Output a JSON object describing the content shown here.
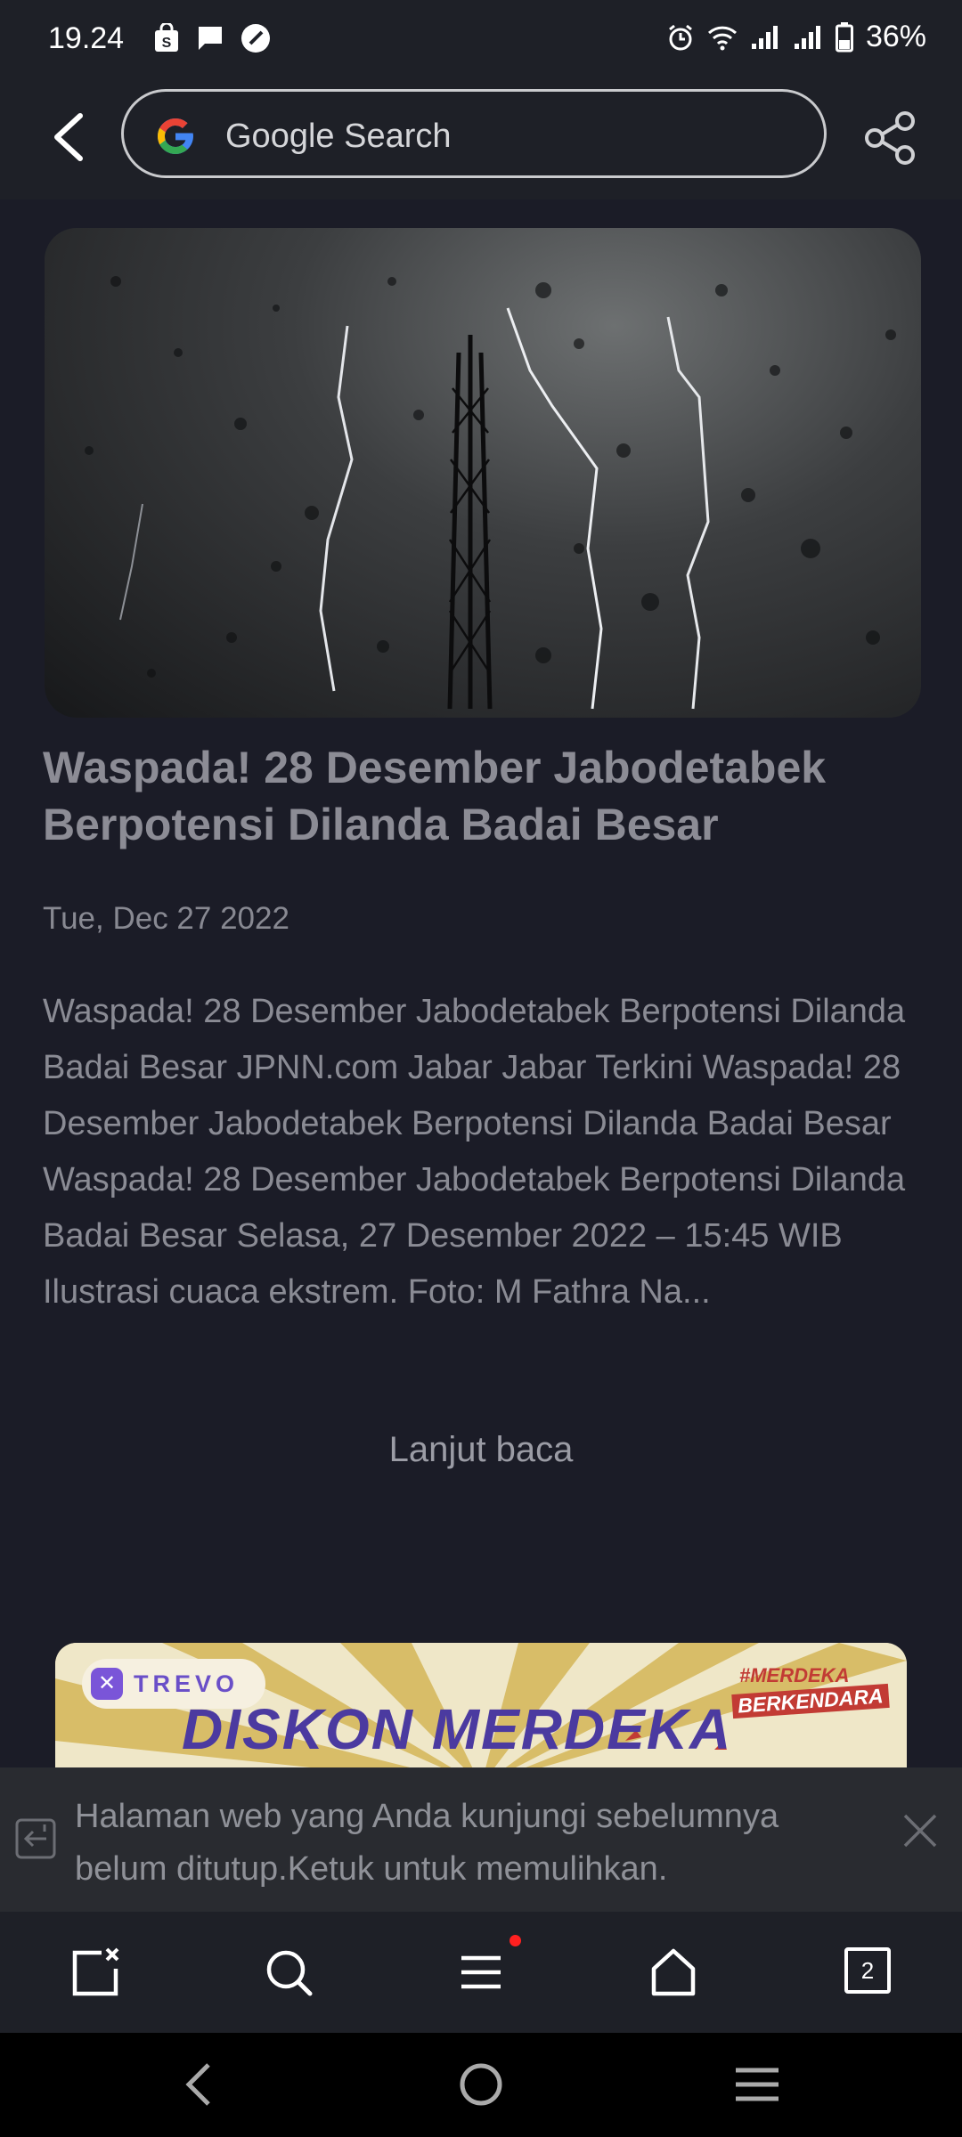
{
  "status_bar": {
    "time": "19.24",
    "battery": "36%",
    "icons": [
      "shopping-bag-icon",
      "chat-icon",
      "speed-icon",
      "alarm-icon",
      "wifi-icon",
      "signal-icon",
      "signal-icon",
      "battery-icon"
    ]
  },
  "top_bar": {
    "search_placeholder": "Google Search",
    "icons": [
      "back-arrow-icon",
      "google-logo-icon",
      "share-icon"
    ]
  },
  "article": {
    "hero_image_description_icon": "storm-lightning-tower-image",
    "title": "Waspada! 28 Desember Jabodetabek Berpotensi Dilanda Badai Besar",
    "date": "Tue, Dec 27 2022",
    "excerpt": "Waspada! 28 Desember Jabodetabek Berpotensi Dilanda Badai Besar JPNN.com Jabar Jabar Terkini Waspada! 28 Desember Jabodetabek Berpotensi Dilanda Badai Besar Waspada! 28 Desember Jabodetabek Berpotensi Dilanda Badai Besar Selasa, 27 Desember 2022 – 15:45 WIB Ilustrasi cuaca ekstrem. Foto: M Fathra Na...",
    "read_more": "Lanjut baca"
  },
  "ad": {
    "brand": "TREVO",
    "brand_icon": "trevo-logo-icon",
    "headline": "DISKON MERDEKA",
    "tag_line1": "#MERDEKA",
    "tag_line2": "BERKENDARA"
  },
  "restore_bar": {
    "message": "Halaman web yang Anda kunjungi sebelumnya belum ditutup.Ketuk untuk memulihkan.",
    "icons": [
      "restore-icon",
      "close-icon"
    ]
  },
  "bottom_nav": {
    "tab_count": "2",
    "icons": [
      "close-tab-icon",
      "search-icon",
      "menu-icon",
      "home-icon",
      "tabs-icon"
    ],
    "menu_badge_color": "#ff2020"
  },
  "system_nav": {
    "icons": [
      "back-icon",
      "home-circle-icon",
      "recents-icon"
    ]
  },
  "colors": {
    "background": "#1b1c27",
    "bar": "#1e2027",
    "restore_bar": "#292b30",
    "text": "#8a8b94"
  }
}
